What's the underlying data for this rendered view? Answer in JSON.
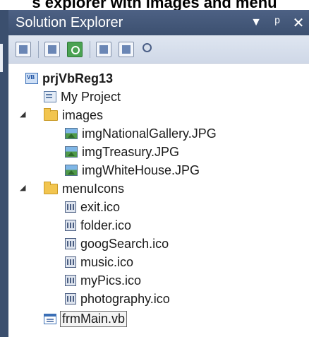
{
  "caption": "s explorer with images and menu",
  "panel": {
    "title": "Solution Explorer",
    "dropdown_icon": "dropdown-arrow-icon",
    "pin_icon": "pin-icon",
    "close_icon": "close-icon"
  },
  "toolbar": {
    "buttons": [
      {
        "name": "properties-button",
        "icon": "properties-icon"
      },
      {
        "name": "show-all-files-button",
        "icon": "show-all-files-icon"
      },
      {
        "name": "refresh-button",
        "icon": "refresh-icon"
      },
      {
        "name": "view-code-button",
        "icon": "view-code-icon"
      },
      {
        "name": "view-designer-button",
        "icon": "view-designer-icon"
      },
      {
        "name": "view-class-diagram-button",
        "icon": "class-diagram-icon"
      }
    ]
  },
  "tree": {
    "project": "prjVbReg13",
    "my_project": "My Project",
    "images_folder": "images",
    "images": [
      "imgNationalGallery.JPG",
      "imgTreasury.JPG",
      "imgWhiteHouse.JPG"
    ],
    "menuicons_folder": "menuIcons",
    "icons": [
      "exit.ico",
      "folder.ico",
      "googSearch.ico",
      "music.ico",
      "myPics.ico",
      "photography.ico"
    ],
    "form": "frmMain.vb",
    "expanded_glyph": "◢"
  },
  "colors": {
    "titlebar": "#4d6184",
    "toolbar": "#dfe6f1",
    "selection_outline": "#6a6a6a"
  }
}
